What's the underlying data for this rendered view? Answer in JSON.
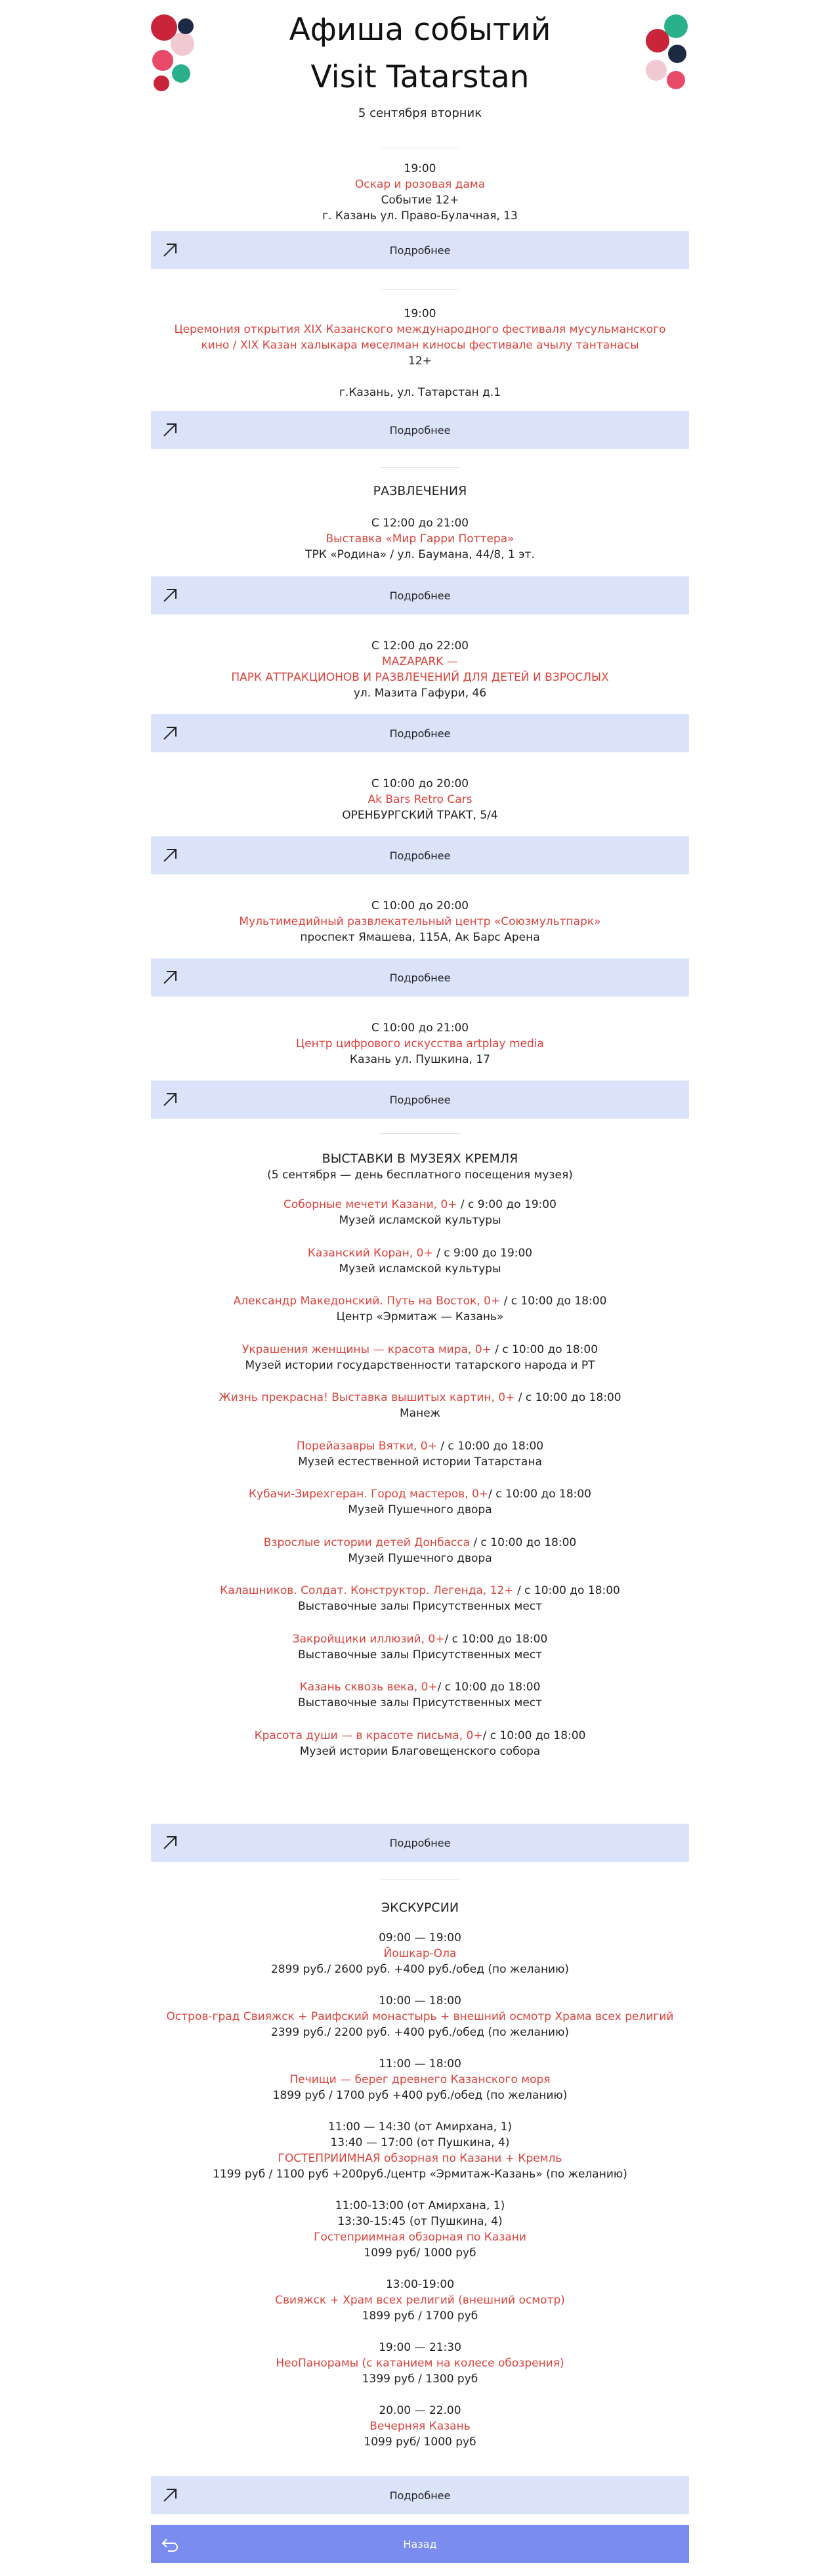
{
  "header": {
    "title_line1": "Афиша событий",
    "title_line2": "Visit Tatarstan",
    "date": "5 сентября вторник"
  },
  "events": [
    {
      "time": "19:00",
      "name": "Оскар и розовая дама",
      "info": "Событие 12+",
      "place": "г. Казань ул. Право-Булачная, 13"
    },
    {
      "time": "19:00",
      "name_line1": "Церемония открытия XIX Казанского международного фестиваля мусульманского",
      "name_line2": "кино / XIX Казан халыкара мөселман киносы фестивале ачылу тантанасы",
      "info": "12+",
      "place": "г.Казань, ул. Татарстан д.1"
    }
  ],
  "entertainment": {
    "heading": "РАЗВЛЕЧЕНИЯ",
    "items": [
      {
        "time": "С 12:00 до 21:00",
        "name": "Выставка «Мир Гарри Поттера»",
        "place": "ТРК «Родина» / ул. Баумана, 44/8, 1 эт."
      },
      {
        "time": "С 12:00 до 22:00",
        "name_line1": "MAZAPARK —",
        "name_line2": "ПАРК АТТРАКЦИОНОВ И РАЗВЛЕЧЕНИЙ ДЛЯ ДЕТЕЙ И ВЗРОСЛЫХ",
        "place": "ул. Мазита Гафури, 46"
      },
      {
        "time": "С 10:00 до 20:00",
        "name": "Ak Bars Retro Cars",
        "place": "ОРЕНБУРГСКИЙ ТРАКТ, 5/4"
      },
      {
        "time": "С 10:00 до 20:00",
        "name": "Мультимедийный развлекательный центр «Союзмультпарк»",
        "place": "проспект Ямашева, 115А, Ак Барс Арена"
      },
      {
        "time": "С 10:00 до 21:00",
        "name": "Центр цифрового искусства artplay media",
        "place": "Казань ул. Пушкина, 17"
      }
    ]
  },
  "museums": {
    "heading": "ВЫСТАВКИ В МУЗЕЯХ КРЕМЛЯ",
    "subheading": "(5 сентября — день бесплатного посещения музея)",
    "items": [
      {
        "name": "Соборные мечети Казани, 0+",
        "time": " / с 9:00 до 19:00",
        "place": "Музей исламской культуры"
      },
      {
        "name": "Казанский Коран, 0+",
        "time": " / с 9:00 до 19:00",
        "place": "Музей исламской культуры"
      },
      {
        "name": "Александр Македонский. Путь на Восток, 0+",
        "time": " / с 10:00 до 18:00",
        "place": "Центр «Эрмитаж — Казань»"
      },
      {
        "name": "Украшения женщины — красота мира, 0+",
        "time": " / с 10:00 до 18:00",
        "place": "Музей истории государственности татарского народа и РТ"
      },
      {
        "name": "Жизнь прекрасна! Выставка вышитых картин, 0+",
        "time": " / с 10:00 до 18:00",
        "place": "Манеж"
      },
      {
        "name": "Порейазавры Вятки, 0+",
        "time": " / с 10:00 до 18:00",
        "place": "Музей естественной истории Татарстана"
      },
      {
        "name": "Кубачи-Зирехгеран. Город мастеров, 0+",
        "time": "/ с 10:00 до 18:00",
        "place": "Музей Пушечного двора"
      },
      {
        "name": "Взрослые истории детей Донбасса",
        "time": " / с 10:00 до 18:00",
        "place": "Музей Пушечного двора"
      },
      {
        "name": "Калашников. Солдат. Конструктор. Легенда, 12+",
        "time": " / с 10:00 до 18:00",
        "place": "Выставочные залы Присутственных мест"
      },
      {
        "name": "Закройщики иллюзий, 0+",
        "time": "/ с 10:00 до 18:00",
        "place": "Выставочные залы Присутственных мест"
      },
      {
        "name": "Казань сквозь века, 0+",
        "time": "/ с 10:00 до 18:00",
        "place": "Выставочные залы Присутственных мест"
      },
      {
        "name": "Красота души — в красоте письма, 0+",
        "time": "/ с 10:00 до 18:00",
        "place": "Музей истории Благовещенского собора"
      }
    ]
  },
  "excursions": {
    "heading": "ЭКСКУРСИИ",
    "items": [
      {
        "time": "09:00 — 19:00",
        "name": "Йошкар-Ола",
        "price": "2899 руб./ 2600 руб. +400 руб./обед (по желанию)"
      },
      {
        "time": "10:00 — 18:00",
        "name": "Остров-град Свияжск + Раифский монастырь + внешний осмотр Храма всех религий",
        "price": "2399 руб./ 2200 руб. +400 руб./обед (по желанию)"
      },
      {
        "time": "11:00 — 18:00",
        "name": "Печищи — берег древнего Казанского моря",
        "price": "1899 руб / 1700 руб +400 руб./обед (по желанию)"
      },
      {
        "time": "11:00 — 14:30 (от Амирхана, 1)",
        "time2": "13:40 — 17:00 (от Пушкина, 4)",
        "name": "ГОСТЕПРИИМНАЯ обзорная по Казани + Кремль",
        "price": "1199 руб / 1100 руб +200руб./центр «Эрмитаж-Казань» (по желанию)"
      },
      {
        "time": "11:00-13:00 (от Амирхана, 1)",
        "time2": "13:30-15:45 (от Пушкина, 4)",
        "name": "Гостеприимная обзорная по Казани",
        "price": "1099 руб/ 1000 руб"
      },
      {
        "time": "13:00-19:00",
        "name": "Свияжск + Храм всех религий (внешний осмотр)",
        "price": "1899 руб / 1700 руб"
      },
      {
        "time": "19:00 — 21:30",
        "name": "НеоПанорамы (с катанием на колесе обозрения)",
        "price": "1399 руб / 1300 руб"
      },
      {
        "time": "20.00 — 22.00",
        "name": "Вечерняя Казань",
        "price": "1099 руб/ 1000 руб"
      }
    ]
  },
  "buttons": {
    "more_label": "Подробнее",
    "back_label": "Назад"
  },
  "colors": {
    "accent_red": "#d9433c",
    "button_bg": "#dbe3fb",
    "back_bg": "#7a8cf0"
  }
}
